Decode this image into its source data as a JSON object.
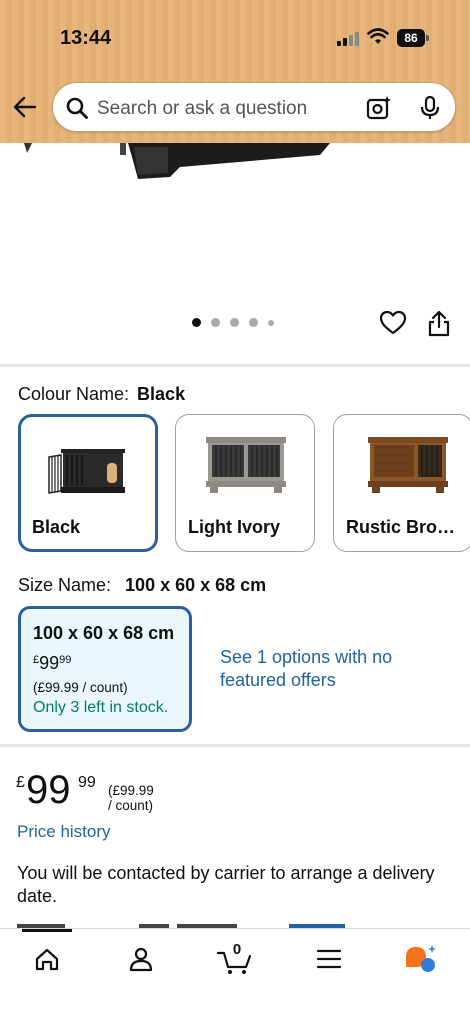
{
  "status_bar": {
    "time": "13:44",
    "battery": "86"
  },
  "search": {
    "placeholder": "Search or ask a question"
  },
  "colour": {
    "label": "Colour Name:",
    "value": "Black",
    "options": [
      {
        "name": "Black",
        "selected": true
      },
      {
        "name": "Light Ivory",
        "selected": false
      },
      {
        "name": "Rustic Bro…",
        "selected": false
      }
    ]
  },
  "size": {
    "label": "Size Name:",
    "value": "100 x 60 x 68 cm",
    "option": {
      "title": "100 x 60 x 68 cm",
      "price_symbol": "£",
      "price_whole": "99",
      "price_fraction": "99",
      "per_count": "(£99.99 / count)",
      "stock": "Only 3 left in stock."
    },
    "see_options": "See 1 options with no featured offers"
  },
  "price": {
    "symbol": "£",
    "whole": "99",
    "fraction": "99",
    "per_count": "(£99.99 / count)"
  },
  "price_history": "Price history",
  "delivery_note": "You will be contacted by carrier to arrange a delivery date.",
  "image_carousel": {
    "dot_count": 5,
    "active_index": 0
  },
  "bottom_nav": {
    "cart_count": "0"
  },
  "colors": {
    "header_bg": "#e7b67d",
    "selected_border": "#2b5fa0",
    "link": "#2162a1",
    "stock_green": "#067d62",
    "alexa_orange": "#f5731b",
    "alexa_blue": "#2f7ce0"
  }
}
